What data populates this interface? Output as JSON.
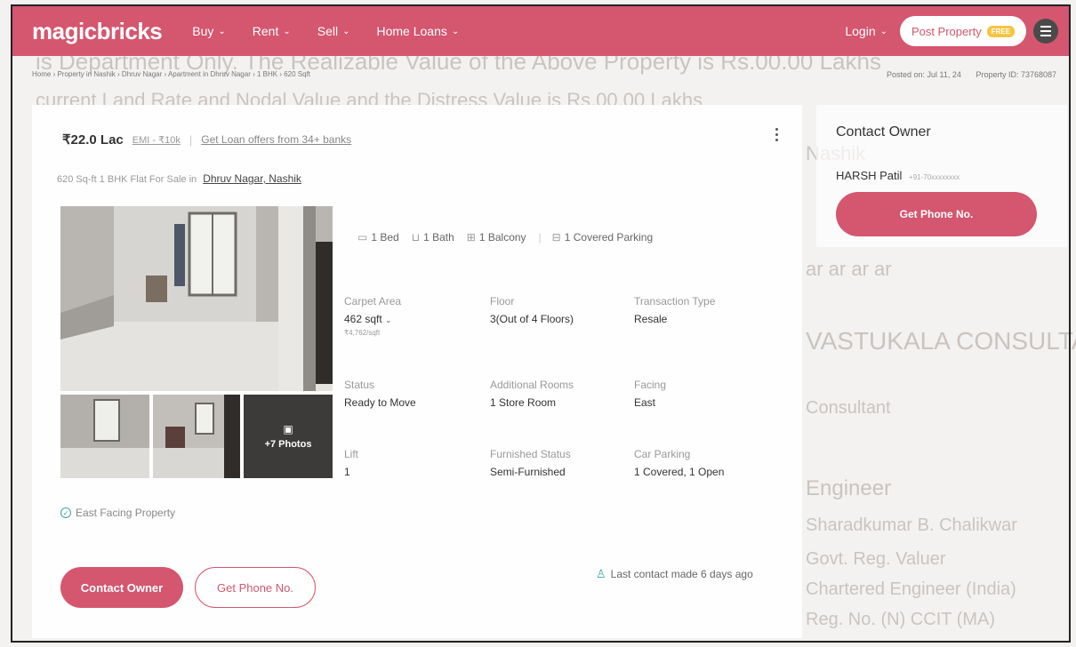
{
  "header": {
    "logo": "magicbricks",
    "nav": [
      {
        "label": "Buy"
      },
      {
        "label": "Rent"
      },
      {
        "label": "Sell"
      },
      {
        "label": "Home Loans"
      }
    ],
    "login": "Login",
    "post_property": "Post Property",
    "free_badge": "FREE"
  },
  "breadcrumb": "Home › Property in Nashik › Dhruv Nagar › Apartment in Dhruv Nagar › 1 BHK › 620 Sqft",
  "meta": {
    "posted": "Posted on: Jul 11, 24",
    "property_id": "Property ID: 73768087"
  },
  "listing": {
    "price": "₹22.0 Lac",
    "emi": "EMI - ₹10k",
    "loan_link": "Get Loan offers from 34+ banks",
    "subtitle": "620 Sq-ft 1 BHK Flat For Sale in",
    "locality": "Dhruv Nagar, Nashik",
    "more_photos": "+7 Photos",
    "amenities": [
      {
        "icon": "bed-icon",
        "label": "1 Bed"
      },
      {
        "icon": "bath-icon",
        "label": "1 Bath"
      },
      {
        "icon": "balcony-icon",
        "label": "1 Balcony"
      },
      {
        "icon": "parking-icon",
        "label": "1 Covered Parking"
      }
    ],
    "details": {
      "carpet_area": {
        "label": "Carpet Area",
        "value": "462 sqft",
        "sub": "₹4,762/sqft"
      },
      "floor": {
        "label": "Floor",
        "value": "3(Out of 4 Floors)"
      },
      "transaction": {
        "label": "Transaction Type",
        "value": "Resale"
      },
      "status": {
        "label": "Status",
        "value": "Ready to Move"
      },
      "rooms": {
        "label": "Additional Rooms",
        "value": "1 Store Room"
      },
      "facing": {
        "label": "Facing",
        "value": "East"
      },
      "lift": {
        "label": "Lift",
        "value": "1"
      },
      "furnished": {
        "label": "Furnished Status",
        "value": "Semi-Furnished"
      },
      "car_parking": {
        "label": "Car Parking",
        "value": "1 Covered, 1 Open"
      }
    },
    "facing_note": "East Facing Property",
    "contact_btn": "Contact Owner",
    "phone_btn": "Get Phone No.",
    "last_contact": "Last contact made 6 days ago"
  },
  "owner": {
    "title": "Contact Owner",
    "name": "HARSH Patil",
    "phone": "+91-70xxxxxxxx",
    "button": "Get Phone No."
  },
  "colors": {
    "brand": "#d4566f",
    "accent_teal": "#3aa6a0"
  }
}
